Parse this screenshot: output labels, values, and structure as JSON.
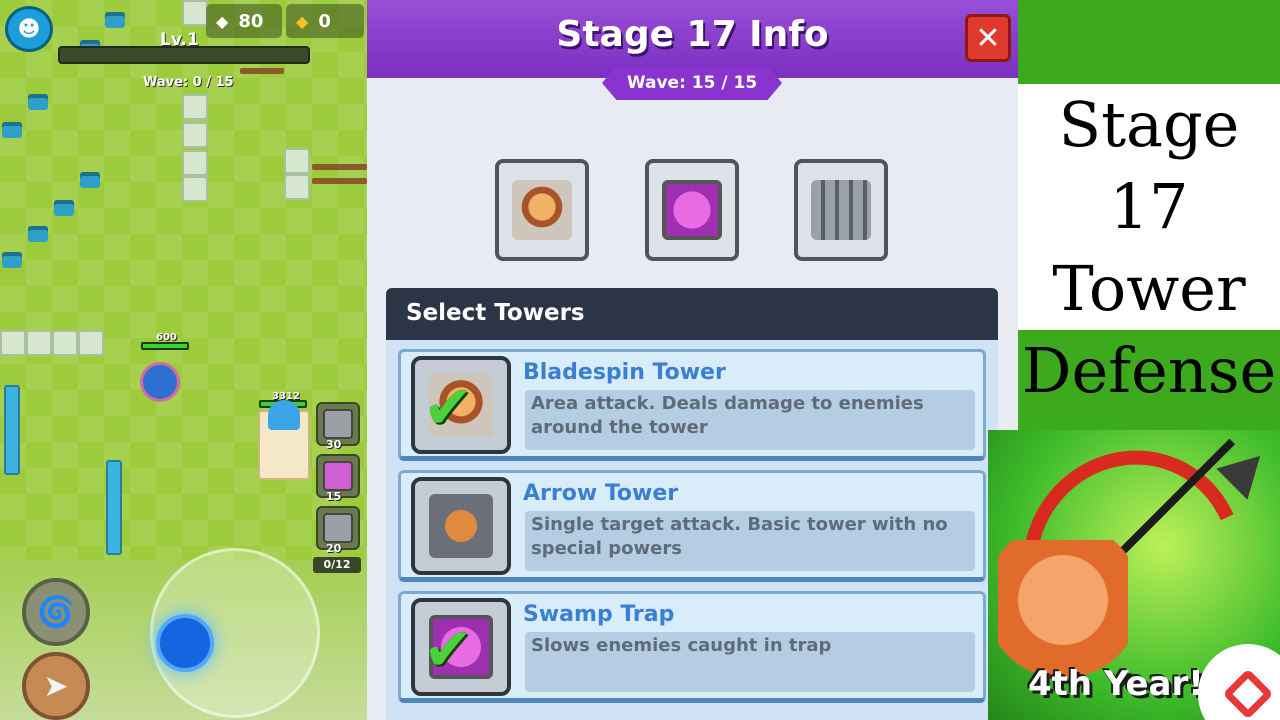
{
  "hud": {
    "gems": "80",
    "gold": "0",
    "level": "Lv.1",
    "wave": "Wave: 0 / 15",
    "hero_hp": "600",
    "castle_hp": "3312",
    "slot_costs": [
      "30",
      "15",
      "20"
    ],
    "slot_count": "0/12"
  },
  "panel": {
    "title": "Stage 17 Info",
    "close_symbol": "✕",
    "wave": "Wave: 15 / 15",
    "stage_towers": [
      "bladespin-tower-icon",
      "swamp-trap-icon",
      "spike-trap-icon"
    ],
    "select_header": "Select Towers",
    "towers": [
      {
        "name": "Bladespin Tower",
        "description": "Area attack. Deals damage to enemies around the tower",
        "selected": true
      },
      {
        "name": "Arrow Tower",
        "description": "Single target attack. Basic tower with no special powers",
        "selected": false
      },
      {
        "name": "Swamp Trap",
        "description": "Slows enemies caught in trap",
        "selected": true
      }
    ]
  },
  "overlay": {
    "title_lines": [
      "Stage 17",
      "Tower",
      "Defense"
    ],
    "promo_text": "4th Year!"
  },
  "colors": {
    "panel_header": "#8a34cf",
    "close_button": "#e0392e",
    "tower_name": "#3a7fd4",
    "check": "#4bd13b"
  }
}
